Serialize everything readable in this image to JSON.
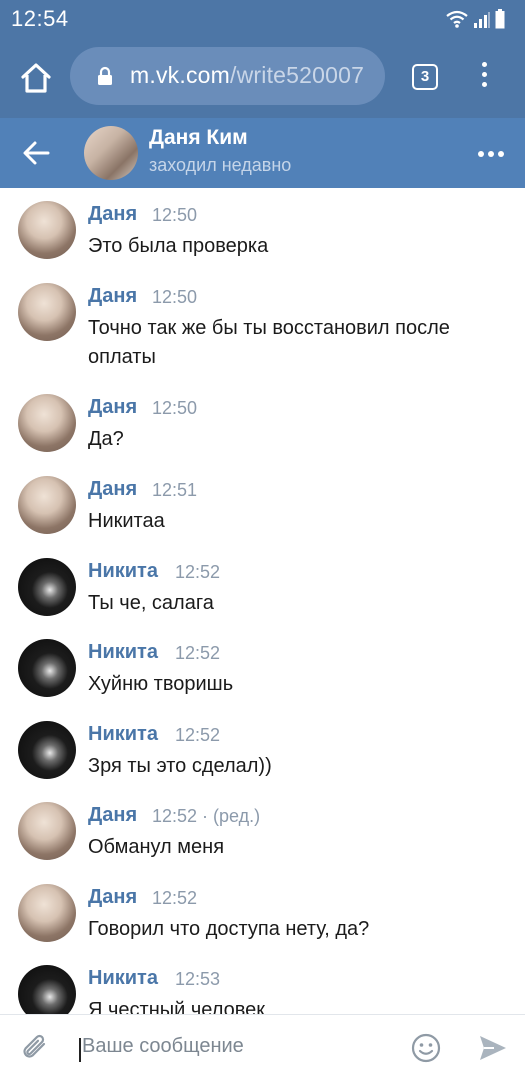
{
  "status_bar": {
    "time": "12:54"
  },
  "browser": {
    "url_host": "m.vk.com",
    "url_path": "/write520007",
    "tab_count": "3"
  },
  "chat": {
    "name": "Даня Ким",
    "status": "заходил недавно"
  },
  "messages": [
    {
      "author": "Даня",
      "time": "12:50",
      "text": "Это была проверка",
      "avatar": "dana"
    },
    {
      "author": "Даня",
      "time": "12:50",
      "text": "Точно так же бы ты восстановил после оплаты",
      "avatar": "dana"
    },
    {
      "author": "Даня",
      "time": "12:50",
      "text": "Да?",
      "avatar": "dana"
    },
    {
      "author": "Даня",
      "time": "12:51",
      "text": "Никитаа",
      "avatar": "dana"
    },
    {
      "author": "Никита",
      "time": "12:52",
      "text": "Ты че, салага",
      "avatar": "nikita"
    },
    {
      "author": "Никита",
      "time": "12:52",
      "text": "Хуйню творишь",
      "avatar": "nikita"
    },
    {
      "author": "Никита",
      "time": "12:52",
      "text": "Зря ты это сделал))",
      "avatar": "nikita"
    },
    {
      "author": "Даня",
      "time": "12:52 · (ред.)",
      "text": "Обманул меня",
      "avatar": "dana"
    },
    {
      "author": "Даня",
      "time": "12:52",
      "text": "Говорил что доступа нету, да?",
      "avatar": "dana"
    },
    {
      "author": "Никита",
      "time": "12:53",
      "text": "Я честный человек",
      "avatar": "nikita"
    }
  ],
  "composer": {
    "placeholder": "Ваше сообщение"
  },
  "colors": {
    "header": "#5181b8",
    "browser": "#4d76a6",
    "author": "#4a76a8",
    "time": "#8c9aab"
  }
}
